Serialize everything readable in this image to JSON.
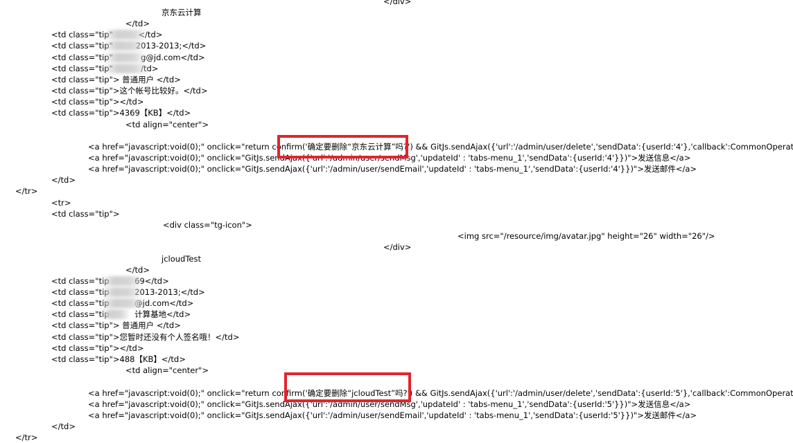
{
  "accent_color": "#e3242b",
  "lines": [
    "</div>",
    "京东云计算",
    "</td>",
    "<td class=\"tip\"          </td>",
    "<td class=\"tip\"         2013-2013;</td>",
    "<td class=\"tip\"           g@jd.com</td>",
    "<td class=\"tip\"           /td>",
    "<td class=\"tip\"> 普通用户 </td>",
    "<td class=\"tip\">这个帐号比较好。</td>",
    "<td class=\"tip\"></td>",
    "<td class=\"tip\">4369【KB】</td>",
    "<td align=\"center\">",
    "<a href=\"javascript:void(0);\" onclick=\"return confirm('确定要删除“京东云计算”吗?') && GitJs.sendAjax({'url':'/admin/user/delete','sendData':{userId:'4'},'callback':CommonOperate.callBac",
    "<a href=\"javascript:void(0);\" onclick=\"GitJs.sendAjax({'url':'/admin/user/sendMsg','updateId' : 'tabs-menu_1','sendData':{userId:'4'}})\">发送信息</a>",
    "<a href=\"javascript:void(0);\" onclick=\"GitJs.sendAjax({'url':'/admin/user/sendEmail','updateId' : 'tabs-menu_1','sendData':{userId:'4'}})\">发送邮件</a>",
    "</td>",
    "</tr>",
    "<tr>",
    "<td class=\"tip\">",
    "<div class=\"tg-icon\">",
    "<img src=\"/resource/img/avatar.jpg\" height=\"26\" width=\"26\"/>",
    "</div>",
    "jcloudTest",
    "</td>",
    "<td class=\"tip          69</td>",
    "<td class=\"tip          2013-2013;</td>",
    "<td class=\"tip          @jd.com</td>",
    "<td class=\"tip          计算基地</td>",
    "<td class=\"tip\"> 普通用户 </td>",
    "<td class=\"tip\">您暂时还没有个人签名哦！</td>",
    "<td class=\"tip\"></td>",
    "<td class=\"tip\">488【KB】</td>",
    "<td align=\"center\">",
    "<a href=\"javascript:void(0);\" onclick=\"return confirm('确定要删除“jcloudTest”吗?') && GitJs.sendAjax({'url':'/admin/user/delete','sendData':{userId:'5'},'callback':CommonOperate.callBac",
    "<a href=\"javascript:void(0);\" onclick=\"GitJs.sendAjax({'url':'/admin/user/sendMsg','updateId' : 'tabs-menu_1','sendData':{userId:'5'}})\">发送信息</a>",
    "<a href=\"javascript:void(0);\" onclick=\"GitJs.sendAjax({'url':'/admin/user/sendEmail','updateId' : 'tabs-menu_1','sendData':{userId:'5'}})\">发送邮件</a>",
    "</td>",
    "</tr>"
  ]
}
